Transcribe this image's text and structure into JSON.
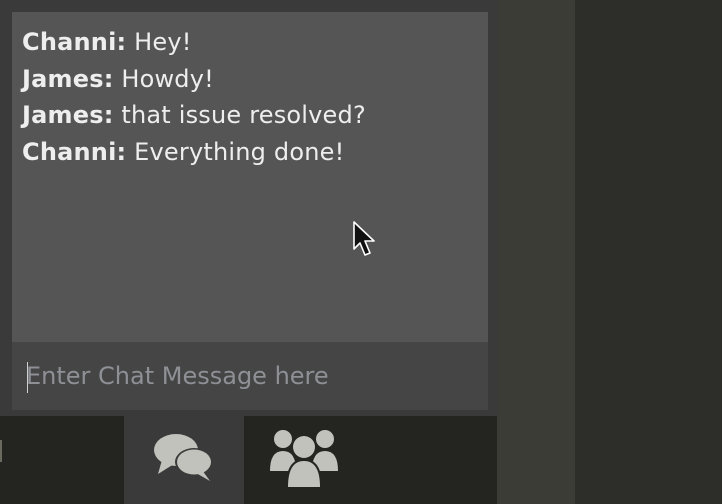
{
  "chat": {
    "messages": [
      {
        "sender": "Channi:",
        "text": "Hey!"
      },
      {
        "sender": "James:",
        "text": "Howdy!"
      },
      {
        "sender": "James:",
        "text": "that issue resolved?"
      },
      {
        "sender": "Channi:",
        "text": "Everything done!"
      }
    ],
    "input": {
      "placeholder": "Enter Chat Message here",
      "value": ""
    }
  },
  "tabs": [
    {
      "icon": "chat-bubbles-icon",
      "active": true
    },
    {
      "icon": "users-group-icon",
      "active": false
    }
  ],
  "colors": {
    "message_bg": "#555555",
    "input_bg": "#454545",
    "tabbar_bg": "#242420",
    "icon": "#c2c2bc"
  }
}
